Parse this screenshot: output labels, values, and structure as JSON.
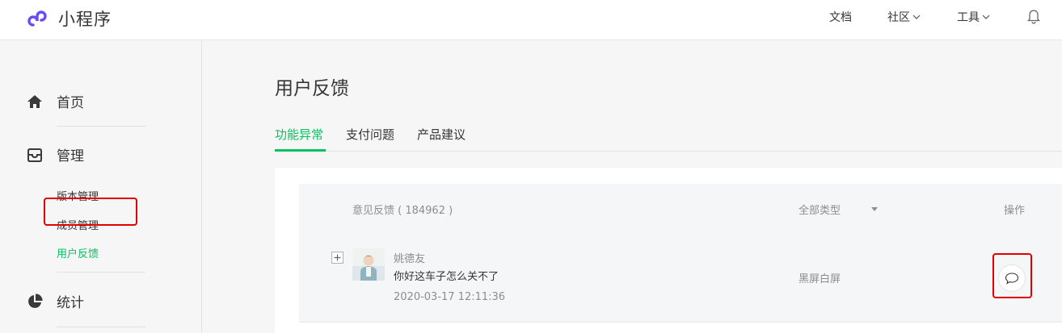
{
  "topbar": {
    "brand": {
      "name": "小程序",
      "logo_icon": "miniprogram-logo-icon"
    },
    "nav": {
      "docs": "文档",
      "community": "社区",
      "tools": "工具",
      "bell_icon": "bell-icon"
    }
  },
  "sidebar": {
    "home": {
      "label": "首页",
      "icon": "home-icon"
    },
    "manage": {
      "label": "管理",
      "icon": "inbox-icon"
    },
    "sub_items": [
      "版本管理",
      "成员管理",
      "用户反馈"
    ],
    "active_sub_item": "用户反馈",
    "stats": {
      "label": "统计",
      "icon": "pie-chart-icon"
    }
  },
  "main": {
    "title": "用户反馈",
    "tabs": [
      "功能异常",
      "支付问题",
      "产品建议"
    ],
    "active_tab": "功能异常",
    "table": {
      "header_feedback": "意见反馈 ( 184962 )",
      "header_type_filter": "全部类型",
      "header_actions": "操作",
      "rows": [
        {
          "user": "姚德友",
          "comment": "你好这车子怎么关不了",
          "time": "2020-03-17 12:11:36",
          "type": "黑屏白屏",
          "expand_icon": "plus-icon",
          "reply_icon": "speech-bubble-icon"
        }
      ]
    }
  },
  "colors": {
    "accent": "#07c160",
    "highlight": "#e10000",
    "brand_purple": "#6a4cf0"
  }
}
